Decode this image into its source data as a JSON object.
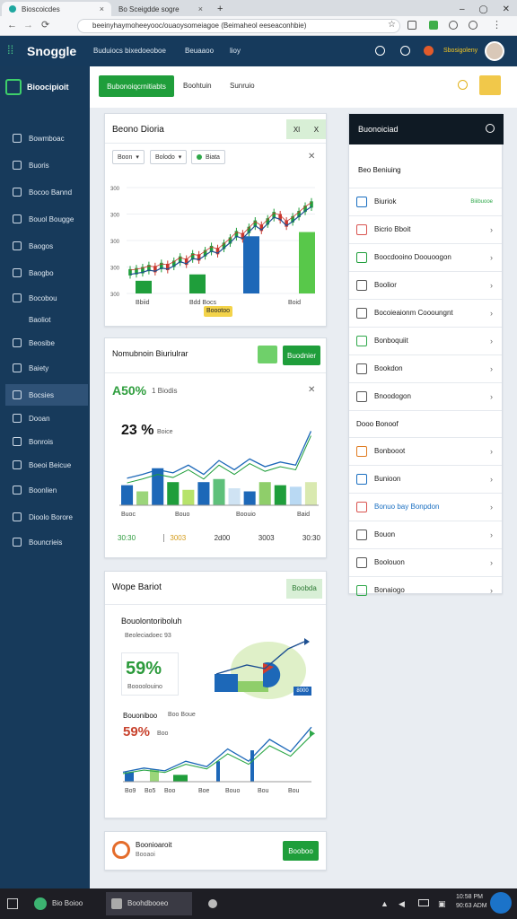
{
  "browser": {
    "tabs": [
      {
        "label": "Bioscoicdes",
        "active": true
      },
      {
        "label": "Bo Sceigdde sogre",
        "active": false
      }
    ],
    "url": "beeinyhaymoheeyooc/ouaoysomeiagoe (Beimaheol eeseaconhbie)"
  },
  "app": {
    "logo": "Snoggle",
    "nav": [
      "Buduiocs bixedoeoboe",
      "Beuaaoo",
      "lioy"
    ],
    "user_name": "Sbosigoleny"
  },
  "sidebar": {
    "brand": "Bioocipioit",
    "items": [
      {
        "label": "Bowmboac",
        "icon": "home-icon",
        "selected": false
      },
      {
        "label": "Buoris",
        "icon": "car-icon",
        "selected": false
      },
      {
        "label": "Bocoo Bannd",
        "icon": "users-icon",
        "selected": false
      },
      {
        "label": "Bouol Bougge",
        "icon": "document-icon",
        "selected": false
      },
      {
        "label": "Baogos",
        "icon": "refresh-icon",
        "selected": false
      },
      {
        "label": "Baogbo",
        "icon": "chart-icon",
        "selected": false
      },
      {
        "label": "Bocobou",
        "icon": "clock-icon",
        "selected": false
      },
      {
        "label": "Baoliot",
        "icon": "",
        "selected": false
      },
      {
        "label": "Beosibe",
        "icon": "gear-icon",
        "selected": false
      },
      {
        "label": "Baiety",
        "icon": "settings-icon",
        "selected": false
      },
      {
        "label": "Bocsies",
        "icon": "folder-icon",
        "selected": true
      },
      {
        "label": "Dooan",
        "icon": "bell-icon",
        "selected": false
      },
      {
        "label": "Bonrois",
        "icon": "target-icon",
        "selected": false
      },
      {
        "label": "Boeoi Beicue",
        "icon": "pen-icon",
        "selected": false
      },
      {
        "label": "Boonlien",
        "icon": "box-icon",
        "selected": false
      },
      {
        "label": "Dioolo Borore",
        "icon": "monitor-icon",
        "selected": false
      },
      {
        "label": "Bouncrieis",
        "icon": "grid-icon",
        "selected": false
      }
    ]
  },
  "toolbar": {
    "primary_button": "Bubonoiqcrnitiabts",
    "tabs": [
      "Boohtuin",
      "Sunruio"
    ]
  },
  "card1": {
    "title": "Beono Dioria",
    "header_chip_a": "Xl",
    "header_chip_b": "X",
    "filter1": "Boon",
    "filter2": "Bolodo",
    "filter3": "Biata",
    "badge": "Boootoo",
    "x_labels": [
      "Bbiid",
      "Bdd Bocs",
      "Boid"
    ],
    "y_labels": [
      "300",
      "300",
      "300",
      "300",
      "300"
    ]
  },
  "card2": {
    "title": "Nomubnoin Biuriulrar",
    "button": "Buodnier",
    "metric": "A50%",
    "metric_sub": "1 Biodis",
    "kpi": "23 %",
    "kpi_sub": "Boice",
    "x_labels": [
      "Buoc",
      "Bouo",
      "Boouio",
      "Baid"
    ],
    "footer": [
      "30:30",
      "3003",
      "2d00",
      "3003",
      "30:30"
    ]
  },
  "card3": {
    "title": "Wope Bariot",
    "badge": "Boobda",
    "section_title": "Bouolontoriboluh",
    "section_sub": "Beoleciadoec 93",
    "big_value": "59%",
    "big_sub": "Boooolouino",
    "legend_tag": "8000",
    "row2_label": "Bouoniboo",
    "row2_sub": "Boo Boue",
    "value2": "59%",
    "value2_sub": "Boo",
    "x_labels": [
      "Bo9",
      "Bo5",
      "Boo",
      "Boe",
      "Bouo",
      "Bou",
      "Bou"
    ]
  },
  "card4": {
    "title": "Boonioaroit",
    "sub": "Booaoi",
    "button": "Booboo"
  },
  "rightpanel": {
    "title": "Buonoiciad",
    "subtitle": "Beo Beniuing",
    "rows": [
      {
        "label": "Biuriok",
        "tag": "Biiibuooe",
        "color": "#1a6fc1",
        "chev": false
      },
      {
        "label": "Bicrio Bboit",
        "color": "#d9534f",
        "chev": true
      },
      {
        "label": "Boocdooino Doouoogon",
        "color": "#1f9e3b",
        "chev": true
      },
      {
        "label": "Boolior",
        "color": "#555555",
        "chev": true
      },
      {
        "label": "Bocoieaionm Coooungnt",
        "color": "#555555",
        "chev": true
      },
      {
        "label": "Bonboquiit",
        "color": "#2fa84a",
        "chev": true
      },
      {
        "label": "Bookdon",
        "color": "#555555",
        "chev": true
      },
      {
        "label": "Bnoodogon",
        "color": "#555555",
        "chev": true
      }
    ],
    "section_label": "Dooo Bonoof",
    "rows2": [
      {
        "label": "Bonbooot",
        "color": "#e07b20",
        "chev": true
      },
      {
        "label": "Bunioon",
        "color": "#1a6fc1",
        "chev": true
      },
      {
        "label": "Bonuo bay Bonpdon",
        "color": "#d9534f",
        "chev": true,
        "accent": true
      },
      {
        "label": "Bouon",
        "color": "#555555",
        "chev": true
      },
      {
        "label": "Boolouon",
        "color": "#555555",
        "chev": true
      },
      {
        "label": "Bonaiogo",
        "color": "#2fa84a",
        "chev": true
      }
    ]
  },
  "taskbar": {
    "item1": "Bio Boioo",
    "item2": "Boohdbooeo",
    "tray": "10:58 PM\n90:63 ADM"
  },
  "chart_data": [
    {
      "type": "line",
      "title": "Beono Dioria",
      "series": [
        {
          "values": [
            20,
            21,
            22,
            24,
            23,
            26,
            25,
            28,
            32,
            30,
            35,
            34,
            38,
            42,
            40,
            45,
            50,
            56,
            54,
            60,
            66,
            62,
            68,
            74,
            72,
            66,
            70,
            75,
            80,
            84
          ]
        }
      ],
      "bars": [
        12,
        18,
        54,
        58
      ],
      "y_tick_labels": [
        "300",
        "300",
        "300",
        "300",
        "300"
      ],
      "x_tick_labels": [
        "Bbiid",
        "Bdd Bocs",
        "Boid"
      ]
    },
    {
      "type": "bar",
      "title": "Nomubnoin Biuriulrar",
      "series": [
        {
          "values": [
            26,
            18,
            48,
            30,
            20,
            30,
            34,
            22,
            18,
            30,
            26,
            24,
            30
          ]
        }
      ],
      "line": [
        35,
        40,
        46,
        42,
        52,
        40,
        58,
        46,
        60,
        50,
        56,
        52,
        96
      ],
      "x_tick_labels": [
        "Buoc",
        "Bouo",
        "Boouio",
        "Baid"
      ]
    },
    {
      "type": "line",
      "title": "Wope Bariot",
      "series": [
        {
          "values": [
            14,
            20,
            16,
            30,
            22,
            48,
            30,
            62,
            44,
            80
          ]
        }
      ],
      "bars": [
        14,
        18,
        10,
        30,
        46
      ],
      "x_tick_labels": [
        "Bo9",
        "Bo5",
        "Boo",
        "Boe",
        "Bouo",
        "Bou",
        "Bou"
      ]
    }
  ]
}
